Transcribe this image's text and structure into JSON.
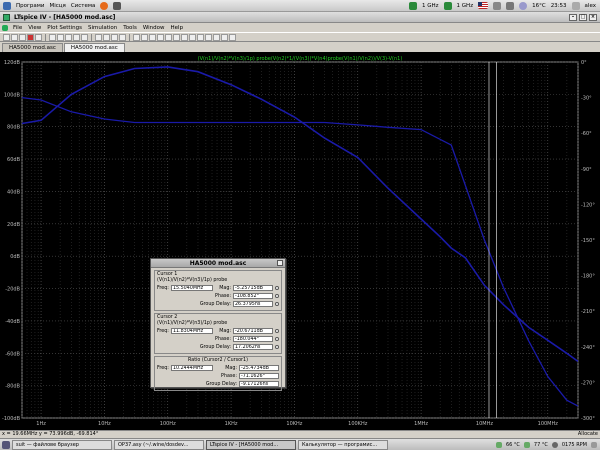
{
  "topbar": {
    "menus": [
      "Програми",
      "Місця",
      "Система"
    ],
    "cpu1": "1 GHz",
    "cpu2": "1 GHz",
    "temp": "16°C",
    "time": "23:53",
    "user": "alex"
  },
  "window": {
    "title": "LTspice IV - [HA5000 mod.asc]"
  },
  "menubar": [
    "File",
    "View",
    "Plot Settings",
    "Simulation",
    "Tools",
    "Window",
    "Help"
  ],
  "tabs": [
    "HA5000 mod.asc",
    "HA5000 mod.asc"
  ],
  "plot": {
    "trace_label": "(V(n1)/V(n2)*V(n3)/1p) probe(V(n2)*1/(V(n3))*V(n4)probe(V(n1)/V(n2))/V(3)-V(n1)",
    "bg_color": "#000000",
    "trace_color": "#1a1aa8",
    "label_color": "#22cc22",
    "cursor_color": "#ffffff",
    "left_ticks": [
      "120dB",
      "100dB",
      "80dB",
      "60dB",
      "40dB",
      "20dB",
      "0dB",
      "-20dB",
      "-40dB",
      "-60dB",
      "-80dB",
      "-100dB"
    ],
    "right_ticks": [
      "0°",
      "-30°",
      "-60°",
      "-90°",
      "-120°",
      "-150°",
      "-180°",
      "-210°",
      "-240°",
      "-270°",
      "-300°"
    ],
    "bottom_ticks": [
      "1Hz",
      "10Hz",
      "100Hz",
      "1KHz",
      "10KHz",
      "100KHz",
      "1MHz",
      "10MHz",
      "100MHz"
    ]
  },
  "chart_data": {
    "type": "line",
    "x_scale": "log",
    "x_range_hz": [
      0.5,
      300000000
    ],
    "y_left_range_db": [
      -100,
      120
    ],
    "y_right_range_deg": [
      -300,
      0
    ],
    "grid": true,
    "series": [
      {
        "x_hz": [
          0.5,
          1,
          3,
          10,
          30,
          100,
          300,
          1000,
          3000,
          10000,
          30000,
          100000,
          300000,
          1000000,
          2000000,
          3000000,
          5000000,
          10000000,
          20000000,
          50000000,
          100000000,
          200000000,
          300000000
        ],
        "y": [
          82,
          84,
          100,
          111,
          116,
          117,
          114,
          106,
          97,
          86,
          73,
          61,
          42,
          23,
          12,
          5,
          -1,
          -18,
          -30,
          -44,
          -52,
          -60,
          -65
        ]
      },
      {
        "x_hz": [
          0.5,
          1,
          3,
          10,
          30,
          100,
          300,
          1000,
          3000,
          10000,
          30000,
          100000,
          300000,
          1000000,
          3000000,
          10000000,
          20000000,
          30000000,
          50000000,
          100000000,
          200000000,
          300000000
        ],
        "y": [
          -30,
          -32,
          -42,
          -48,
          -51,
          -51,
          -51,
          -51,
          -51,
          -51,
          -51,
          -53,
          -55,
          -57,
          -70,
          -150,
          -190,
          -210,
          -235,
          -265,
          -285,
          -290
        ]
      }
    ],
    "cursors_hz": [
      15400000,
      11800000
    ]
  },
  "cursor_dialog": {
    "title": "HA5000 mod.asc",
    "cursor1": {
      "header": "Cursor 1",
      "expr": "(V(n1)/V(n2)*V(n3)/1p) probe",
      "freq_label": "Freq:",
      "freq": "15.5040MHz",
      "mag_label": "Mag:",
      "mag": "-5.25715dB",
      "phase_label": "Phase:",
      "phase": "-108.852°",
      "gd_label": "Group Delay:",
      "gd": "26.3795ns"
    },
    "cursor2": {
      "header": "Cursor 2",
      "expr": "(V(n1)/V(n2)*V(n3)/1p) probe",
      "freq_label": "Freq:",
      "freq": "11.8304MHz",
      "mag_label": "Mag:",
      "mag": "-20.6711dB",
      "phase_label": "Phase:",
      "phase": "-180.044°",
      "gd_label": "Group Delay:",
      "gd": "17.2062ns"
    },
    "ratio": {
      "header": "Ratio (Cursor2 / Cursor1)",
      "freq_label": "Freq:",
      "freq": "10.2444MHz",
      "mag_label": "Mag:",
      "mag": "-25.4734dB",
      "phase_label": "Phase:",
      "phase": "-71.1626°",
      "gd_label": "Group Delay:",
      "gd": "-9.17126ns"
    }
  },
  "statusbar": {
    "left": "x = 19.66MHz    y = 73.996dB, -69.814°",
    "right": "Allocate"
  },
  "taskbar": {
    "tasks": [
      "suit — файлове браузер",
      "OP37.asy (~/.wine/dosdev...",
      "LTspice IV - [HA5000 mod...",
      "Калькулятор — програмис..."
    ],
    "tray": [
      "66 °C",
      "77 °C",
      "0175 RPM"
    ]
  }
}
